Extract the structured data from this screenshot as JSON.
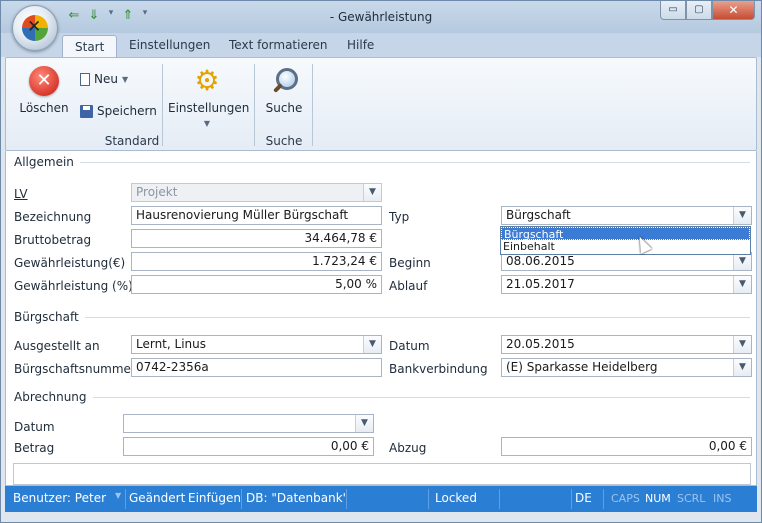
{
  "window": {
    "title": "- Gewährleistung",
    "buttons": [
      "▭",
      "▢",
      "✕"
    ]
  },
  "quick_access": [
    "⇐",
    "⇓",
    "▾",
    "⇑",
    "▾"
  ],
  "tabs": [
    "Start",
    "Einstellungen",
    "Text formatieren",
    "Hilfe"
  ],
  "ribbon": {
    "delete": "Löschen",
    "new": "Neu",
    "save": "Speichern",
    "settings": "Einstellungen",
    "search": "Suche",
    "group_standard": "Standard",
    "group_search": "Suche"
  },
  "sections": {
    "allgemein": "Allgemein",
    "buergschaft": "Bürgschaft",
    "abrechnung": "Abrechnung"
  },
  "form": {
    "lv_label": "LV",
    "lv_value": "Projekt",
    "bezeichnung_label": "Bezeichnung",
    "bezeichnung_value": "Hausrenovierung Müller Bürgschaft",
    "typ_label": "Typ",
    "typ_value": "Bürgschaft",
    "typ_options": [
      "Bürgschaft",
      "Einbehalt"
    ],
    "brutto_label": "Bruttobetrag",
    "brutto_value": "34.464,78 €",
    "gew_eur_label": "Gewährleistung(€)",
    "gew_eur_value": "1.723,24 €",
    "beginn_label": "Beginn",
    "beginn_value": "08.06.2015",
    "gew_pct_label": "Gewährleistung (%)",
    "gew_pct_value": "5,00 %",
    "ablauf_label": "Ablauf",
    "ablauf_value": "21.05.2017",
    "ausgestellt_label": "Ausgestellt an",
    "ausgestellt_value": "Lernt, Linus",
    "datum_label": "Datum",
    "datum_value": "20.05.2015",
    "nummer_label": "Bürgschaftsnummer",
    "nummer_value": "0742-2356a",
    "bank_label": "Bankverbindung",
    "bank_value": "(E) Sparkasse Heidelberg",
    "abr_datum_label": "Datum",
    "abr_datum_value": "",
    "betrag_label": "Betrag",
    "betrag_value": "0,00 €",
    "abzug_label": "Abzug",
    "abzug_value": "0,00 €"
  },
  "status": {
    "user": "Benutzer: Peter",
    "changed": "Geändert",
    "insert": "Einfügen",
    "db": "DB: \"Datenbank\"",
    "locked": "Locked",
    "lang": "DE",
    "caps": "CAPS",
    "num": "NUM",
    "scrl": "SCRL",
    "ins": "INS"
  }
}
